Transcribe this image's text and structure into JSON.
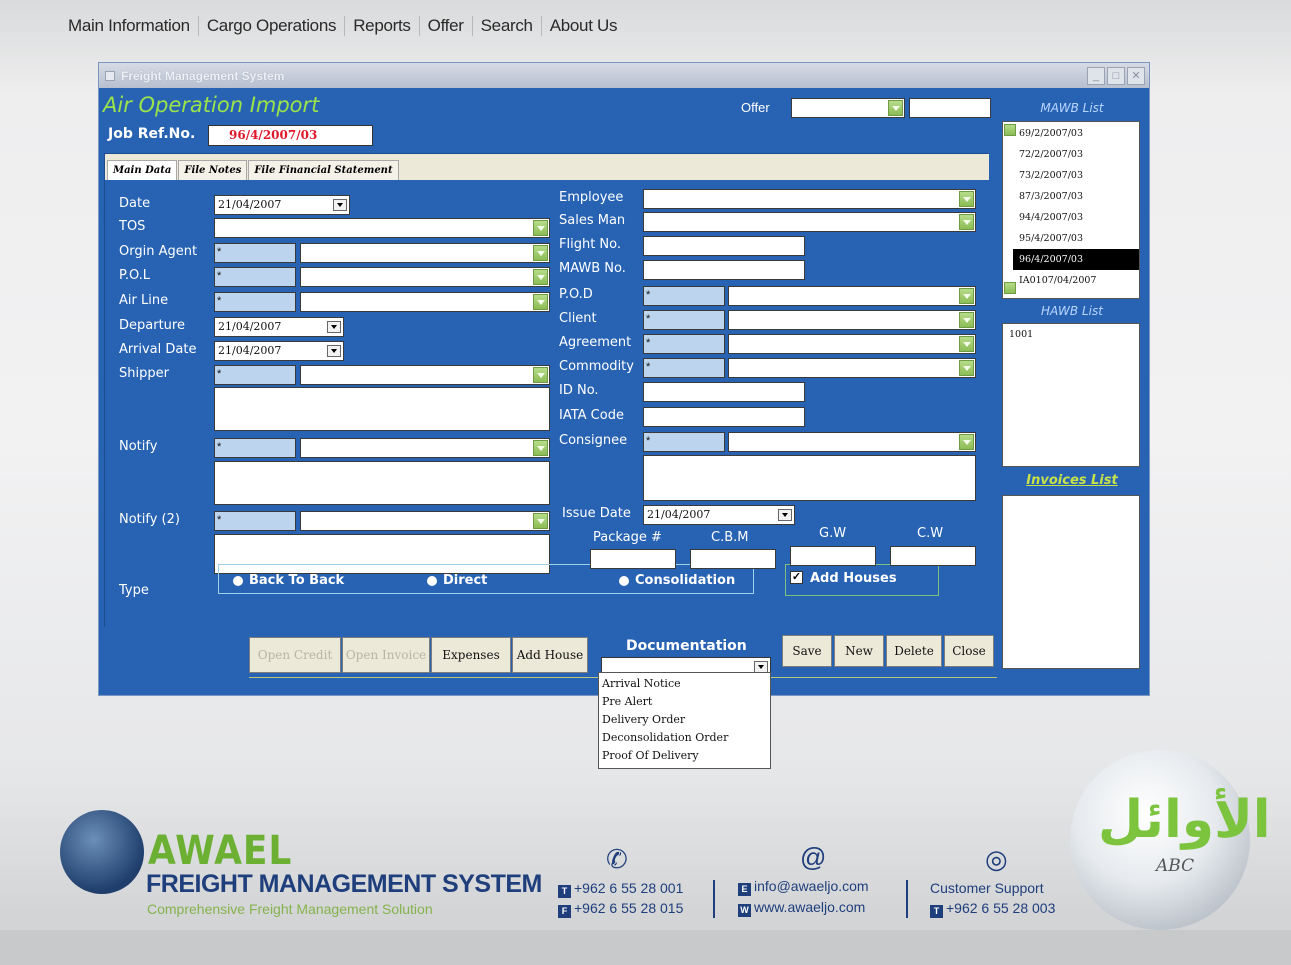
{
  "menu": [
    "Main Information",
    "Cargo Operations",
    "Reports",
    "Offer",
    "Search",
    "About Us"
  ],
  "window": {
    "title": "Freight Management System",
    "heading": "Air Operation Import",
    "offer_label": "Offer",
    "jobref_label": "Job Ref.No.",
    "jobref_value": "96/4/2007/03"
  },
  "tabs": [
    "Main Data",
    "File Notes",
    "File Financial Statement"
  ],
  "left_form": {
    "date_label": "Date",
    "date_value": "21/04/2007",
    "tos_label": "TOS",
    "origin_agent_label": "Orgin Agent",
    "pol_label": "P.O.L",
    "airline_label": "Air Line",
    "departure_label": "Departure",
    "departure_value": "21/04/2007",
    "arrival_label": "Arrival Date",
    "arrival_value": "21/04/2007",
    "shipper_label": "Shipper",
    "notify_label": "Notify",
    "notify2_label": "Notify (2)",
    "type_label": "Type",
    "code_placeholder": "*"
  },
  "right_form": {
    "employee_label": "Employee",
    "salesman_label": "Sales Man",
    "flight_label": "Flight No.",
    "mawb_label": "MAWB No.",
    "pod_label": "P.O.D",
    "client_label": "Client",
    "agreement_label": "Agreement",
    "commodity_label": "Commodity",
    "id_label": "ID No.",
    "iata_label": "IATA Code",
    "consignee_label": "Consignee",
    "issue_label": "Issue Date",
    "issue_value": "21/04/2007",
    "package_label": "Package #",
    "cbm_label": "C.B.M",
    "gw_label": "G.W",
    "cw_label": "C.W"
  },
  "type_options": [
    "Back To Back",
    "Direct",
    "Consolidation"
  ],
  "add_houses_label": "Add Houses",
  "buttons": {
    "open_credit": "Open Credit",
    "open_invoice": "Open Invoice",
    "expenses": "Expenses",
    "add_house": "Add House",
    "save": "Save",
    "new": "New",
    "delete": "Delete",
    "close": "Close"
  },
  "documentation": {
    "label": "Documentation",
    "options": [
      "Arrival Notice",
      "Pre Alert",
      "Delivery Order",
      "Deconsolidation Order",
      "Proof Of Delivery"
    ]
  },
  "side": {
    "mawb_label": "MAWB List",
    "mawb_items": [
      "69/2/2007/03",
      "72/2/2007/03",
      "73/2/2007/03",
      "87/3/2007/03",
      "94/4/2007/03",
      "95/4/2007/03",
      "96/4/2007/03",
      "IA0107/04/2007"
    ],
    "mawb_selected_index": 6,
    "hawb_label": "HAWB List",
    "hawb_items": [
      "1001"
    ],
    "invoices_label": "Invoices List"
  },
  "footer": {
    "brand": "AWAEL",
    "title": "FREIGHT MANAGEMENT SYSTEM",
    "tagline": "Comprehensive Freight Management Solution",
    "phone1": "+962 6 55 28 001",
    "phone2": "+962 6 55 28 015",
    "email": "info@awaeljo.com",
    "web": "www.awaeljo.com",
    "support_label": "Customer Support",
    "support_phone": "+962 6 55 28 003",
    "logo_arabic": "الأوائل",
    "logo_en": "ABC"
  },
  "colors": {
    "window_bg": "#2863b3",
    "heading": "#9be34b",
    "jobref": "#e0192b",
    "brand_green": "#6cb033",
    "brand_blue": "#1f3e7c"
  }
}
